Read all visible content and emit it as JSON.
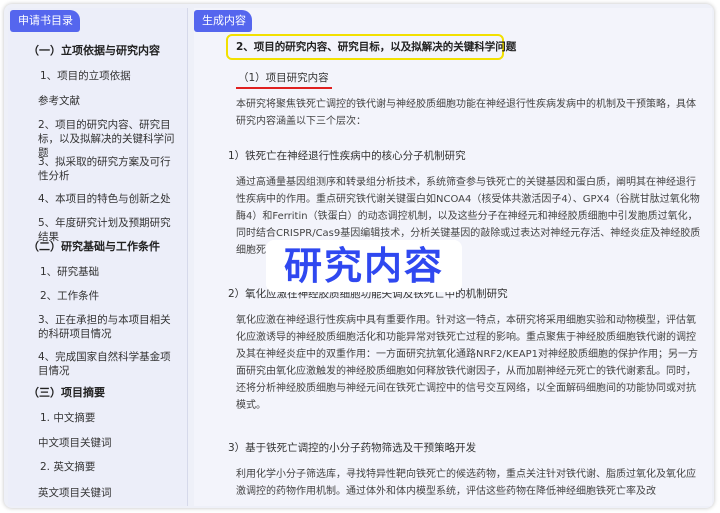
{
  "sidebar": {
    "tab_label": "申请书目录",
    "items": [
      {
        "label": "（一）立项依据与研究内容",
        "section": true
      },
      {
        "label": "1、项目的立项依据",
        "section": false
      },
      {
        "label": "参考文献",
        "section": false
      },
      {
        "label": "2、项目的研究内容、研究目标，以及拟解决的关键科学问题",
        "section": false
      },
      {
        "label": "3、拟采取的研究方案及可行性分析",
        "section": false
      },
      {
        "label": "4、本项目的特色与创新之处",
        "section": false
      },
      {
        "label": "5、年度研究计划及预期研究结果",
        "section": false
      },
      {
        "label": "（二）研究基础与工作条件",
        "section": true
      },
      {
        "label": "1、研究基础",
        "section": false
      },
      {
        "label": "2、工作条件",
        "section": false
      },
      {
        "label": "3、正在承担的与本项目相关的科研项目情况",
        "section": false
      },
      {
        "label": "4、完成国家自然科学基金项目情况",
        "section": false
      },
      {
        "label": "（三）项目摘要",
        "section": true
      },
      {
        "label": "1. 中文摘要",
        "section": false
      },
      {
        "label": "中文项目关键词",
        "section": false
      },
      {
        "label": "2. 英文摘要",
        "section": false
      },
      {
        "label": "英文项目关键词",
        "section": false
      }
    ]
  },
  "content": {
    "tab_label": "生成内容",
    "heading": "2、项目的研究内容、研究目标，以及拟解决的关键科学问题",
    "subheading": "（1）项目研究内容",
    "intro": "本研究将聚焦铁死亡调控的铁代谢与神经胶质细胞功能在神经退行性疾病发病中的机制及干预策略，具体研究内容涵盖以下三个层次：",
    "section1_title": "1）铁死亡在神经退行性疾病中的核心分子机制研究",
    "section1_body": "通过高通量基因组测序和转录组分析技术，系统筛查参与铁死亡的关键基因和蛋白质，阐明其在神经退行性疾病中的作用。重点研究铁代谢关键蛋白如NCOA4（核受体共激活因子4）、GPX4（谷胱甘肽过氧化物酶4）和Ferritin（铁蛋白）的动态调控机制，以及这些分子在神经元和神经胶质细胞中引发胞质过氧化，同时结合CRISPR/Cas9基因编辑技术，分析关键基因的敲除或过表达对神经元存活、神经炎症及神经胶质细胞死亡的具体分子路径。",
    "section2_title": "2）氧化应激在神经胶质细胞功能失调及铁死亡中的机制研究",
    "section2_body": "氧化应激在神经退行性疾病中具有重要作用。针对这一特点，本研究将采用细胞实验和动物模型，评估氧化应激诱导的神经胶质细胞活化和功能异常对铁死亡过程的影响。重点聚焦于神经胶质细胞铁代谢的调控及其在神经炎症中的双重作用：一方面研究抗氧化通路NRF2/KEAP1对神经胶质细胞的保护作用；另一方面研究由氧化应激触发的神经胶质细胞如何释放铁代谢因子，从而加剧神经元死亡的铁代谢紊乱。同时，还将分析神经胶质细胞与神经元间在铁死亡调控中的信号交互网络，以全面解码细胞间的功能协同或对抗模式。",
    "section3_title": "3）基于铁死亡调控的小分子药物筛选及干预策略开发",
    "section3_body": "利用化学小分子筛选库，寻找特异性靶向铁死亡的候选药物，重点关注针对铁代谢、脂质过氧化及氧化应激调控的药物作用机制。通过体外和体内模型系统，评估这些药物在降低神经细胞铁死亡率及改"
  },
  "overlay": {
    "title": "研究内容"
  },
  "colors": {
    "accent": "#5566ee",
    "overlay_text": "#2f48f0",
    "highlight_border": "#f2e000",
    "underline": "#e02020"
  }
}
